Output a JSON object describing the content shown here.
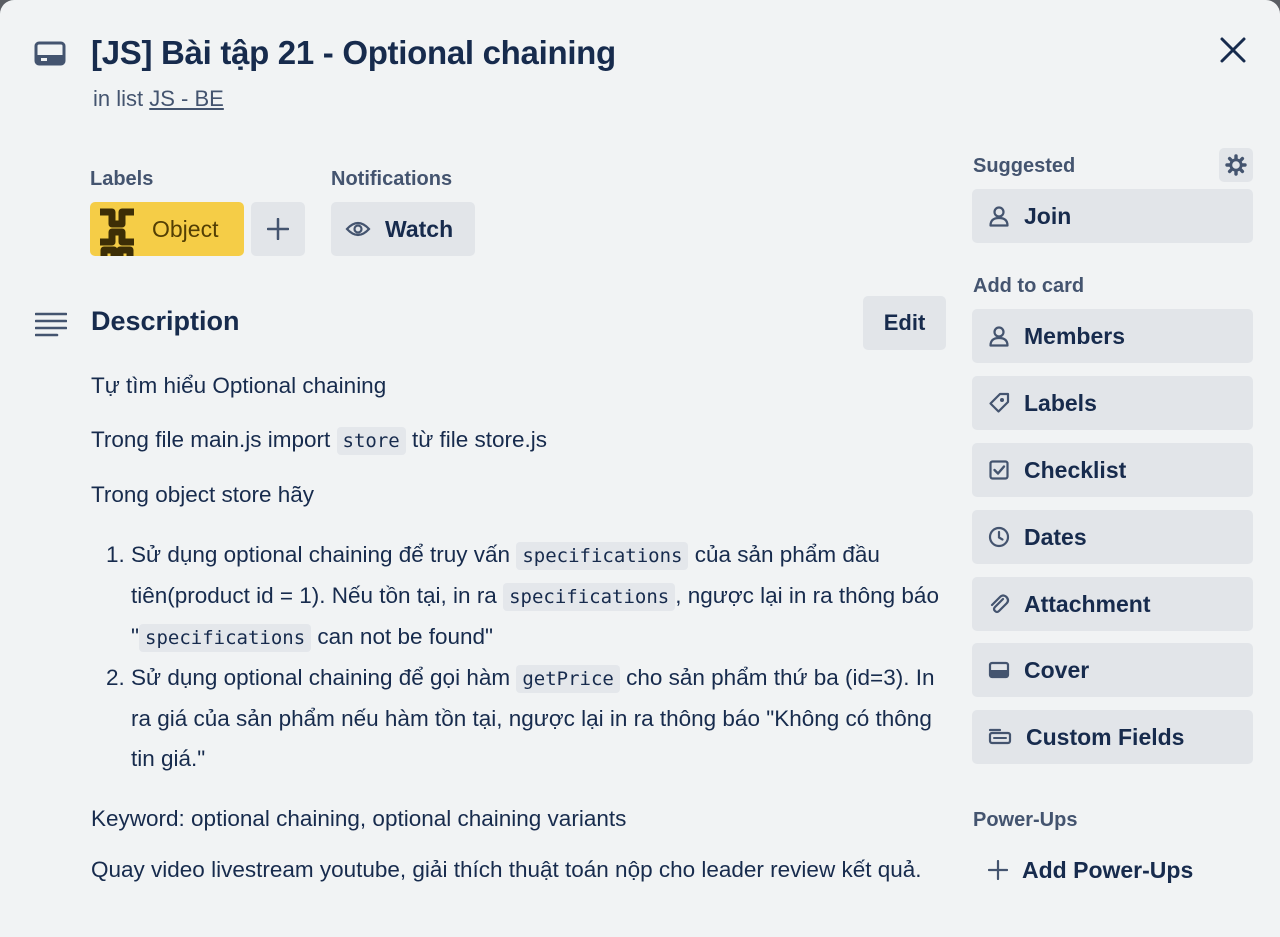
{
  "card": {
    "title": "[JS] Bài tập 21 - Optional chaining",
    "in_list_prefix": "in list",
    "list_name": "JS - BE"
  },
  "labels_section": {
    "heading": "Labels",
    "labels": [
      {
        "name": "Object",
        "color": "#f5cd47"
      }
    ]
  },
  "notifications_section": {
    "heading": "Notifications",
    "watch_label": "Watch"
  },
  "description": {
    "heading": "Description",
    "edit_label": "Edit",
    "p1": "Tự tìm hiểu Optional chaining",
    "p2_before": "Trong file main.js import ",
    "p2_code": "store",
    "p2_after": " từ file store.js",
    "p3": "Trong object store hãy",
    "item1_a": "Sử dụng optional chaining để truy vấn ",
    "item1_code1": "specifications",
    "item1_b": " của sản phẩm đầu tiên(product id = 1). Nếu tồn tại, in ra ",
    "item1_code2": "specifications",
    "item1_c": ", ngược lại in ra thông báo \"",
    "item1_code3": "specifications",
    "item1_d": " can not be found\"",
    "item2_a": "Sử dụng optional chaining để gọi hàm ",
    "item2_code": "getPrice",
    "item2_b": " cho sản phẩm thứ ba (id=3). In ra giá của sản phẩm nếu hàm tồn tại, ngược lại in ra thông báo \"Không có thông tin giá.\"",
    "p4": "Keyword: optional chaining, optional chaining variants",
    "p5": "Quay video livestream youtube, giải thích thuật toán nộp cho leader review kết quả."
  },
  "sidebar": {
    "suggested_heading": "Suggested",
    "join_label": "Join",
    "add_to_card_heading": "Add to card",
    "items": [
      {
        "label": "Members",
        "icon": "person-icon"
      },
      {
        "label": "Labels",
        "icon": "tag-icon"
      },
      {
        "label": "Checklist",
        "icon": "checkbox-icon"
      },
      {
        "label": "Dates",
        "icon": "clock-icon"
      },
      {
        "label": "Attachment",
        "icon": "paperclip-icon"
      },
      {
        "label": "Cover",
        "icon": "cover-icon"
      },
      {
        "label": "Custom Fields",
        "icon": "custom-fields-icon"
      }
    ],
    "powerups_heading": "Power-Ups",
    "add_powerups_label": "Add Power-Ups"
  },
  "colors": {
    "modal_bg": "#f1f3f4",
    "button_bg": "#e2e5e9",
    "label_yellow": "#f5cd47",
    "text_primary": "#172b4d",
    "text_subtle": "#44546f"
  }
}
